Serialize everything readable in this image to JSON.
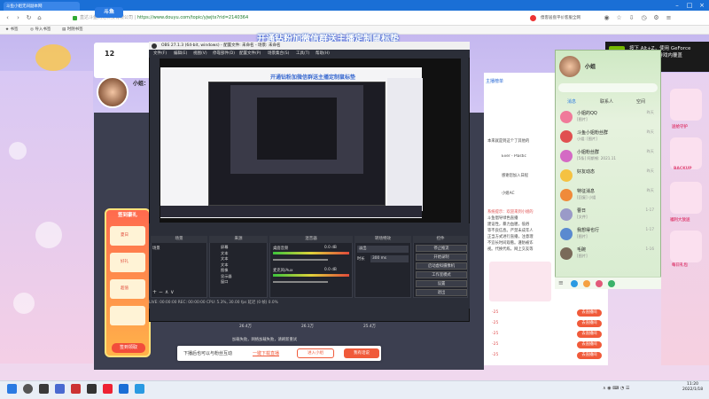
{
  "browser": {
    "tab_title": "斗鱼小姐无间副本网",
    "url_host": "直达斗鱼网络科技有限公司 | ",
    "url": "https://www.douyu.com/topic/yjwjtx?rid=2140364",
    "search_text": "傻客居盘平价客服全网",
    "bookmarks": [
      "书签",
      "导入书签",
      "时阴书签"
    ]
  },
  "page": {
    "logo": "斗鱼",
    "banner": "开通钻粉加微信群送主播定制鼠标垫",
    "fans_count": "12",
    "streamer_name": "小姐：",
    "gift_pack_title": "签到豪礼",
    "signin_button": "签到领取",
    "gift_labels": [
      "夏日",
      "好礼",
      "超值"
    ],
    "rank_header": "主播榜单",
    "chat_lines": [
      "本来就是到这个了其他的",
      "Ever - Plastic",
      "感谢您加入日程",
      "小姐AC",
      "系统提示：欢迎来到小姐的",
      "斗鱼倡导绿色直播",
      "建设性，暴力血腥，低俗",
      "等不良信息。严禁未成年人",
      "正当方式进行直播，注意理",
      "不宜长时间观看。谨防被诈",
      "视。代换代练，网上交友等"
    ],
    "rank_rows": [
      "-25",
      "-25",
      "-25",
      "-25",
      "-25"
    ],
    "red_button": "去直播间",
    "stream_captions": [
      "看布组...可能为 – 一起来…",
      "网表提示正在打开",
      "看布组 – 看提提 已看..."
    ],
    "stream_stats": [
      "26.4万",
      "26.1万",
      "25.4万"
    ],
    "stream_warn": "加载失败，网络加载失败，请刷新重试",
    "toast_text": "下播后也可以与粉丝互动",
    "toast_link": "一键下载直播",
    "toast_btn1": "进入小组",
    "toast_btn2": "我有话说"
  },
  "obs": {
    "title": "OBS 27.1.3 (64-bit, windows) - 配置文件: 未命名 - 场景: 未命名",
    "menu": [
      "文件(F)",
      "编辑(E)",
      "视图(V)",
      "停靠部件(D)",
      "配置文件(P)",
      "场景集合(S)",
      "工具(T)",
      "帮助(H)"
    ],
    "panels": [
      "场景",
      "来源",
      "混音器",
      "转场特效",
      "控件"
    ],
    "scene_item": "场景",
    "source_items": [
      "屏幕",
      "文本",
      "文本",
      "文本",
      "图像",
      "显示器",
      "窗口"
    ],
    "mixer_channels": [
      "桌面音频",
      "麦克风/Aux"
    ],
    "mixer_level": "0.0 dB",
    "transition": "淡出",
    "duration_label": "时长",
    "duration": "300 ms",
    "controls": [
      "停止推流",
      "开始录制",
      "启动虚拟摄像机",
      "工作室模式",
      "设置",
      "退出"
    ],
    "status": "LIVE: 00:00:00   REC: 00:00:00   CPU: 5.3%, 30.00 fps   延迟 (0 帧) 0.0%",
    "preview_banner": "开通钻粉加微信群送主播定制鼠标垫"
  },
  "qq": {
    "name": "小姐",
    "tabs": [
      "消息",
      "联系人",
      "空间"
    ],
    "items": [
      {
        "title": "小姐的QQ",
        "sub": "[图片]",
        "date": "昨天",
        "color": "#f07a9a"
      },
      {
        "title": "斗鱼小姐粉丝群",
        "sub": "小姐: [图片]",
        "date": "昨天",
        "color": "#e05050"
      },
      {
        "title": "小姐粉丝群",
        "sub": "[5条] 阿斯顿: 2021.11",
        "date": "昨天",
        "color": "#d46ac4"
      },
      {
        "title": "好友动态",
        "sub": "",
        "date": "昨天",
        "color": "#f5c242"
      },
      {
        "title": "特征消息",
        "sub": "[回复] 小姐",
        "date": "昨天",
        "color": "#f08a3a"
      },
      {
        "title": "曹日",
        "sub": "[文件]",
        "date": "1-17",
        "color": "#9a9ac8"
      },
      {
        "title": "我想得也行",
        "sub": "[图片]",
        "date": "1-17",
        "color": "#5a8ad0"
      },
      {
        "title": "毛碗",
        "sub": "[图片]",
        "date": "1-16",
        "color": "#7a6a5a"
      }
    ]
  },
  "geforce": {
    "text": "按下 Alt+Z，使用 GeForce Experience 游戏内覆盖"
  },
  "right_deco": [
    "送给守护",
    "BACKUP",
    "福利大放送",
    "每日礼包"
  ],
  "taskbar": {
    "time": "11:20",
    "date": "2022/1/18"
  }
}
